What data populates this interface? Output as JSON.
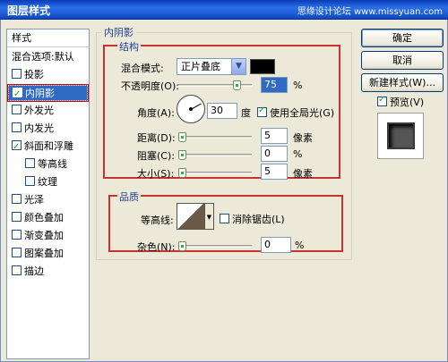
{
  "window": {
    "title": "图层样式",
    "watermark": "思缘设计论坛 www.missyuan.com"
  },
  "style_list": {
    "header": "样式",
    "items": [
      {
        "label": "混合选项:默认",
        "checkbox": false,
        "checked": false
      },
      {
        "label": "投影",
        "checkbox": true,
        "checked": false
      },
      {
        "label": "内阴影",
        "checkbox": true,
        "checked": true,
        "selected": true
      },
      {
        "label": "外发光",
        "checkbox": true,
        "checked": false
      },
      {
        "label": "内发光",
        "checkbox": true,
        "checked": false
      },
      {
        "label": "斜面和浮雕",
        "checkbox": true,
        "checked": true
      },
      {
        "label": "等高线",
        "checkbox": true,
        "checked": false,
        "indent": true
      },
      {
        "label": "纹理",
        "checkbox": true,
        "checked": false,
        "indent": true
      },
      {
        "label": "光泽",
        "checkbox": true,
        "checked": false
      },
      {
        "label": "颜色叠加",
        "checkbox": true,
        "checked": false
      },
      {
        "label": "渐变叠加",
        "checkbox": true,
        "checked": false
      },
      {
        "label": "图案叠加",
        "checkbox": true,
        "checked": false
      },
      {
        "label": "描边",
        "checkbox": true,
        "checked": false
      }
    ]
  },
  "inner_shadow": {
    "section_title": "内阴影",
    "structure": {
      "title": "结构",
      "blend_mode_label": "混合模式:",
      "blend_mode_value": "正片叠底",
      "shadow_color": "#000000",
      "opacity_label": "不透明度(O):",
      "opacity_value": "75",
      "opacity_unit": "%",
      "angle_label": "角度(A):",
      "angle_value": "30",
      "angle_unit": "度",
      "global_light_label": "使用全局光(G)",
      "global_light_checked": true,
      "distance_label": "距离(D):",
      "distance_value": "5",
      "distance_unit": "像素",
      "choke_label": "阻塞(C):",
      "choke_value": "0",
      "choke_unit": "%",
      "size_label": "大小(S):",
      "size_value": "5",
      "size_unit": "像素"
    },
    "quality": {
      "title": "品质",
      "contour_label": "等高线:",
      "anti_alias_label": "消除锯齿(L)",
      "anti_alias_checked": false,
      "noise_label": "杂色(N):",
      "noise_value": "0",
      "noise_unit": "%"
    }
  },
  "buttons": {
    "ok": "确定",
    "cancel": "取消",
    "new_style": "新建样式(W)...",
    "preview_label": "预览(V)",
    "preview_checked": true
  }
}
